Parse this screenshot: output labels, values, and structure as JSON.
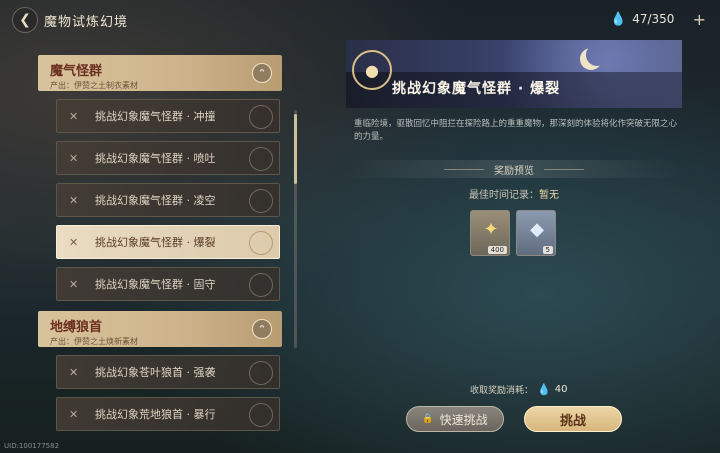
{
  "header": {
    "title": "魔物试炼幻境",
    "stamina": "47/350",
    "plus": "+"
  },
  "groups": [
    {
      "name": "魔气怪群",
      "subtitle": "产出：伊赞之土制衣素材",
      "levels": [
        "挑战幻象魔气怪群 · 冲撞",
        "挑战幻象魔气怪群 · 喷吐",
        "挑战幻象魔气怪群 · 凌空",
        "挑战幻象魔气怪群 · 爆裂",
        "挑战幻象魔气怪群 · 固守"
      ]
    },
    {
      "name": "地缚狼首",
      "subtitle": "产出：伊赞之土焕新素材",
      "levels": [
        "挑战幻象苍叶狼首 · 强袭",
        "挑战幻象荒地狼首 · 暴行"
      ]
    }
  ],
  "detail": {
    "title": "挑战幻象魔气怪群 · 爆裂",
    "description": "重临险境，驱散回忆中阻拦在探险路上的重重魔物，那深刻的体验将化作突破无限之心的力量。",
    "reward_preview": "奖励预览",
    "best_time_label": "最佳时间记录：",
    "best_time_value": "暂无",
    "rewards": [
      {
        "icon": "gold-crest-icon",
        "count": "400"
      },
      {
        "icon": "crystal-shard-icon",
        "count": "5"
      }
    ],
    "cost_label": "收取奖励消耗：",
    "cost_value": "40",
    "quick_button": "快速挑战",
    "challenge_button": "挑战"
  },
  "uid": "UID:100177582",
  "colors": {
    "accent_gold": "#d7b67c",
    "header_cream": "#d8c39c",
    "stamina_blue": "#8fb6ff"
  }
}
